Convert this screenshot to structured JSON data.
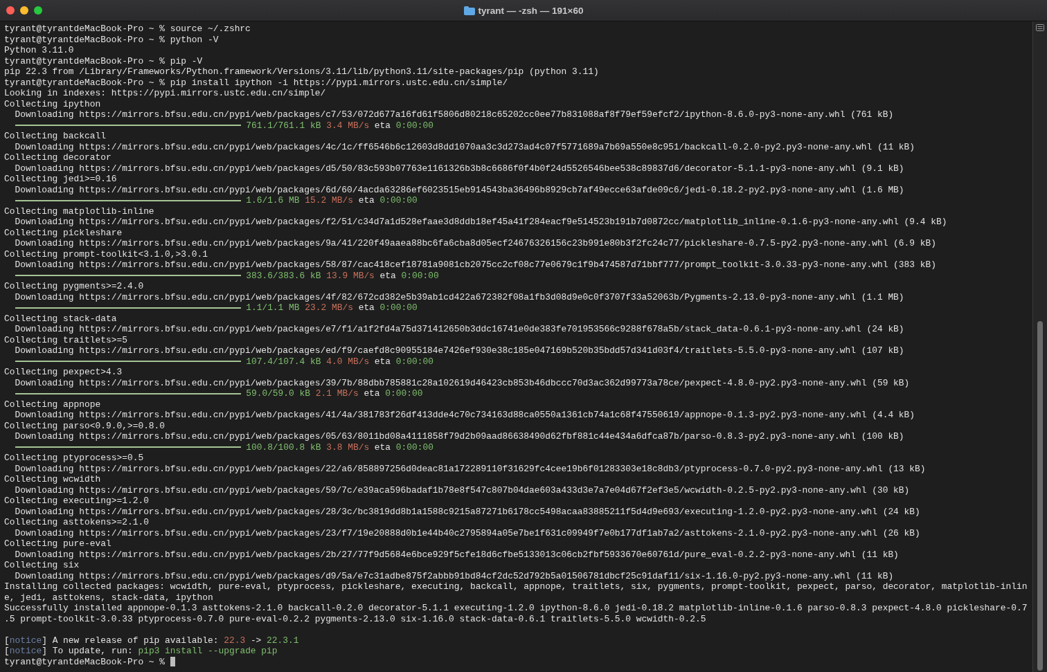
{
  "window": {
    "title": "tyrant — -zsh — 191×60"
  },
  "lines": [
    {
      "kind": "text",
      "text": "tyrant@tyrantdeMacBook-Pro ~ % source ~/.zshrc"
    },
    {
      "kind": "text",
      "text": "tyrant@tyrantdeMacBook-Pro ~ % python -V"
    },
    {
      "kind": "text",
      "text": "Python 3.11.0"
    },
    {
      "kind": "text",
      "text": "tyrant@tyrantdeMacBook-Pro ~ % pip -V"
    },
    {
      "kind": "text",
      "text": "pip 22.3 from /Library/Frameworks/Python.framework/Versions/3.11/lib/python3.11/site-packages/pip (python 3.11)"
    },
    {
      "kind": "text",
      "text": "tyrant@tyrantdeMacBook-Pro ~ % pip install ipython -i https://pypi.mirrors.ustc.edu.cn/simple/"
    },
    {
      "kind": "text",
      "text": "Looking in indexes: https://pypi.mirrors.ustc.edu.cn/simple/"
    },
    {
      "kind": "text",
      "text": "Collecting ipython"
    },
    {
      "kind": "text",
      "text": "  Downloading https://mirrors.bfsu.edu.cn/pypi/web/packages/c7/53/072d677a16fd61f5806d80218c65202cc0ee77b831088af8f79ef59efcf2/ipython-8.6.0-py3-none-any.whl (761 kB)"
    },
    {
      "kind": "progress",
      "level": 1,
      "size": "761.1/761.1 kB",
      "speed": "3.4 MB/s",
      "eta_label": "eta",
      "eta": "0:00:00"
    },
    {
      "kind": "text",
      "text": "Collecting backcall"
    },
    {
      "kind": "text",
      "text": "  Downloading https://mirrors.bfsu.edu.cn/pypi/web/packages/4c/1c/ff6546b6c12603d8dd1070aa3c3d273ad4c07f5771689a7b69a550e8c951/backcall-0.2.0-py2.py3-none-any.whl (11 kB)"
    },
    {
      "kind": "text",
      "text": "Collecting decorator"
    },
    {
      "kind": "text",
      "text": "  Downloading https://mirrors.bfsu.edu.cn/pypi/web/packages/d5/50/83c593b07763e1161326b3b8c6686f0f4b0f24d5526546bee538c89837d6/decorator-5.1.1-py3-none-any.whl (9.1 kB)"
    },
    {
      "kind": "text",
      "text": "Collecting jedi>=0.16"
    },
    {
      "kind": "text",
      "text": "  Downloading https://mirrors.bfsu.edu.cn/pypi/web/packages/6d/60/4acda63286ef6023515eb914543ba36496b8929cb7af49ecce63afde09c6/jedi-0.18.2-py2.py3-none-any.whl (1.6 MB)"
    },
    {
      "kind": "progress",
      "level": 1,
      "size": "1.6/1.6 MB",
      "speed": "15.2 MB/s",
      "eta_label": "eta",
      "eta": "0:00:00"
    },
    {
      "kind": "text",
      "text": "Collecting matplotlib-inline"
    },
    {
      "kind": "text",
      "text": "  Downloading https://mirrors.bfsu.edu.cn/pypi/web/packages/f2/51/c34d7a1d528efaae3d8ddb18ef45a41f284eacf9e514523b191b7d0872cc/matplotlib_inline-0.1.6-py3-none-any.whl (9.4 kB)"
    },
    {
      "kind": "text",
      "text": "Collecting pickleshare"
    },
    {
      "kind": "text",
      "text": "  Downloading https://mirrors.bfsu.edu.cn/pypi/web/packages/9a/41/220f49aaea88bc6fa6cba8d05ecf24676326156c23b991e80b3f2fc24c77/pickleshare-0.7.5-py2.py3-none-any.whl (6.9 kB)"
    },
    {
      "kind": "text",
      "text": "Collecting prompt-toolkit<3.1.0,>3.0.1"
    },
    {
      "kind": "text",
      "text": "  Downloading https://mirrors.bfsu.edu.cn/pypi/web/packages/58/87/cac418cef18781a9081cb2075cc2cf08c77e0679c1f9b474587d71bbf777/prompt_toolkit-3.0.33-py3-none-any.whl (383 kB)"
    },
    {
      "kind": "progress",
      "level": 1,
      "size": "383.6/383.6 kB",
      "speed": "13.9 MB/s",
      "eta_label": "eta",
      "eta": "0:00:00"
    },
    {
      "kind": "text",
      "text": "Collecting pygments>=2.4.0"
    },
    {
      "kind": "text",
      "text": "  Downloading https://mirrors.bfsu.edu.cn/pypi/web/packages/4f/82/672cd382e5b39ab1cd422a672382f08a1fb3d08d9e0c0f3707f33a52063b/Pygments-2.13.0-py3-none-any.whl (1.1 MB)"
    },
    {
      "kind": "progress",
      "level": 1,
      "size": "1.1/1.1 MB",
      "speed": "23.2 MB/s",
      "eta_label": "eta",
      "eta": "0:00:00"
    },
    {
      "kind": "text",
      "text": "Collecting stack-data"
    },
    {
      "kind": "text",
      "text": "  Downloading https://mirrors.bfsu.edu.cn/pypi/web/packages/e7/f1/a1f2fd4a75d371412650b3ddc16741e0de383fe701953566c9288f678a5b/stack_data-0.6.1-py3-none-any.whl (24 kB)"
    },
    {
      "kind": "text",
      "text": "Collecting traitlets>=5"
    },
    {
      "kind": "text",
      "text": "  Downloading https://mirrors.bfsu.edu.cn/pypi/web/packages/ed/f9/caefd8c90955184e7426ef930e38c185e047169b520b35bdd57d341d03f4/traitlets-5.5.0-py3-none-any.whl (107 kB)"
    },
    {
      "kind": "progress",
      "level": 1,
      "size": "107.4/107.4 kB",
      "speed": "4.0 MB/s",
      "eta_label": "eta",
      "eta": "0:00:00"
    },
    {
      "kind": "text",
      "text": "Collecting pexpect>4.3"
    },
    {
      "kind": "text",
      "text": "  Downloading https://mirrors.bfsu.edu.cn/pypi/web/packages/39/7b/88dbb785881c28a102619d46423cb853b46dbccc70d3ac362d99773a78ce/pexpect-4.8.0-py2.py3-none-any.whl (59 kB)"
    },
    {
      "kind": "progress",
      "level": 1,
      "size": "59.0/59.0 kB",
      "speed": "2.1 MB/s",
      "eta_label": "eta",
      "eta": "0:00:00"
    },
    {
      "kind": "text",
      "text": "Collecting appnope"
    },
    {
      "kind": "text",
      "text": "  Downloading https://mirrors.bfsu.edu.cn/pypi/web/packages/41/4a/381783f26df413dde4c70c734163d88ca0550a1361cb74a1c68f47550619/appnope-0.1.3-py2.py3-none-any.whl (4.4 kB)"
    },
    {
      "kind": "text",
      "text": "Collecting parso<0.9.0,>=0.8.0"
    },
    {
      "kind": "text",
      "text": "  Downloading https://mirrors.bfsu.edu.cn/pypi/web/packages/05/63/8011bd08a4111858f79d2b09aad86638490d62fbf881c44e434a6dfca87b/parso-0.8.3-py2.py3-none-any.whl (100 kB)"
    },
    {
      "kind": "progress",
      "level": 1,
      "size": "100.8/100.8 kB",
      "speed": "3.8 MB/s",
      "eta_label": "eta",
      "eta": "0:00:00"
    },
    {
      "kind": "text",
      "text": "Collecting ptyprocess>=0.5"
    },
    {
      "kind": "text",
      "text": "  Downloading https://mirrors.bfsu.edu.cn/pypi/web/packages/22/a6/858897256d0deac81a172289110f31629fc4cee19b6f01283303e18c8db3/ptyprocess-0.7.0-py2.py3-none-any.whl (13 kB)"
    },
    {
      "kind": "text",
      "text": "Collecting wcwidth"
    },
    {
      "kind": "text",
      "text": "  Downloading https://mirrors.bfsu.edu.cn/pypi/web/packages/59/7c/e39aca596badaf1b78e8f547c807b04dae603a433d3e7a7e04d67f2ef3e5/wcwidth-0.2.5-py2.py3-none-any.whl (30 kB)"
    },
    {
      "kind": "text",
      "text": "Collecting executing>=1.2.0"
    },
    {
      "kind": "text",
      "text": "  Downloading https://mirrors.bfsu.edu.cn/pypi/web/packages/28/3c/bc3819dd8b1a1588c9215a87271b6178cc5498acaa83885211f5d4d9e693/executing-1.2.0-py2.py3-none-any.whl (24 kB)"
    },
    {
      "kind": "text",
      "text": "Collecting asttokens>=2.1.0"
    },
    {
      "kind": "text",
      "text": "  Downloading https://mirrors.bfsu.edu.cn/pypi/web/packages/23/f7/19e20888d0b1e44b40c2795894a05e7be1f631c09949f7e0b177df1ab7a2/asttokens-2.1.0-py2.py3-none-any.whl (26 kB)"
    },
    {
      "kind": "text",
      "text": "Collecting pure-eval"
    },
    {
      "kind": "text",
      "text": "  Downloading https://mirrors.bfsu.edu.cn/pypi/web/packages/2b/27/77f9d5684e6bce929f5cfe18d6cfbe5133013c06cb2fbf5933670e60761d/pure_eval-0.2.2-py3-none-any.whl (11 kB)"
    },
    {
      "kind": "text",
      "text": "Collecting six"
    },
    {
      "kind": "text",
      "text": "  Downloading https://mirrors.bfsu.edu.cn/pypi/web/packages/d9/5a/e7c31adbe875f2abbb91bd84cf2dc52d792b5a01506781dbcf25c91daf11/six-1.16.0-py2.py3-none-any.whl (11 kB)"
    },
    {
      "kind": "text",
      "text": "Installing collected packages: wcwidth, pure-eval, ptyprocess, pickleshare, executing, backcall, appnope, traitlets, six, pygments, prompt-toolkit, pexpect, parso, decorator, matplotlib-inlin"
    },
    {
      "kind": "text",
      "text": "e, jedi, asttokens, stack-data, ipython"
    },
    {
      "kind": "text",
      "text": "Successfully installed appnope-0.1.3 asttokens-2.1.0 backcall-0.2.0 decorator-5.1.1 executing-1.2.0 ipython-8.6.0 jedi-0.18.2 matplotlib-inline-0.1.6 parso-0.8.3 pexpect-4.8.0 pickleshare-0.7"
    },
    {
      "kind": "text",
      "text": ".5 prompt-toolkit-3.0.33 ptyprocess-0.7.0 pure-eval-0.2.2 pygments-2.13.0 six-1.16.0 stack-data-0.6.1 traitlets-5.5.0 wcwidth-0.2.5"
    },
    {
      "kind": "blank"
    },
    {
      "kind": "segments",
      "segments": [
        {
          "text": "[",
          "kind": "plain"
        },
        {
          "text": "notice",
          "kind": "tag"
        },
        {
          "text": "] A new release of pip available:",
          "kind": "plain"
        },
        {
          "text": "22.3",
          "kind": "old"
        },
        {
          "text": "->",
          "kind": "plain"
        },
        {
          "text": "22.3.1",
          "kind": "new"
        }
      ]
    },
    {
      "kind": "segments",
      "segments": [
        {
          "text": "[",
          "kind": "plain"
        },
        {
          "text": "notice",
          "kind": "tag"
        },
        {
          "text": "] To update, run:",
          "kind": "plain"
        },
        {
          "text": "pip3 install --upgrade pip",
          "kind": "new"
        }
      ]
    },
    {
      "kind": "prompt",
      "text": "tyrant@tyrantdeMacBook-Pro ~ %",
      "cursor": true
    }
  ]
}
